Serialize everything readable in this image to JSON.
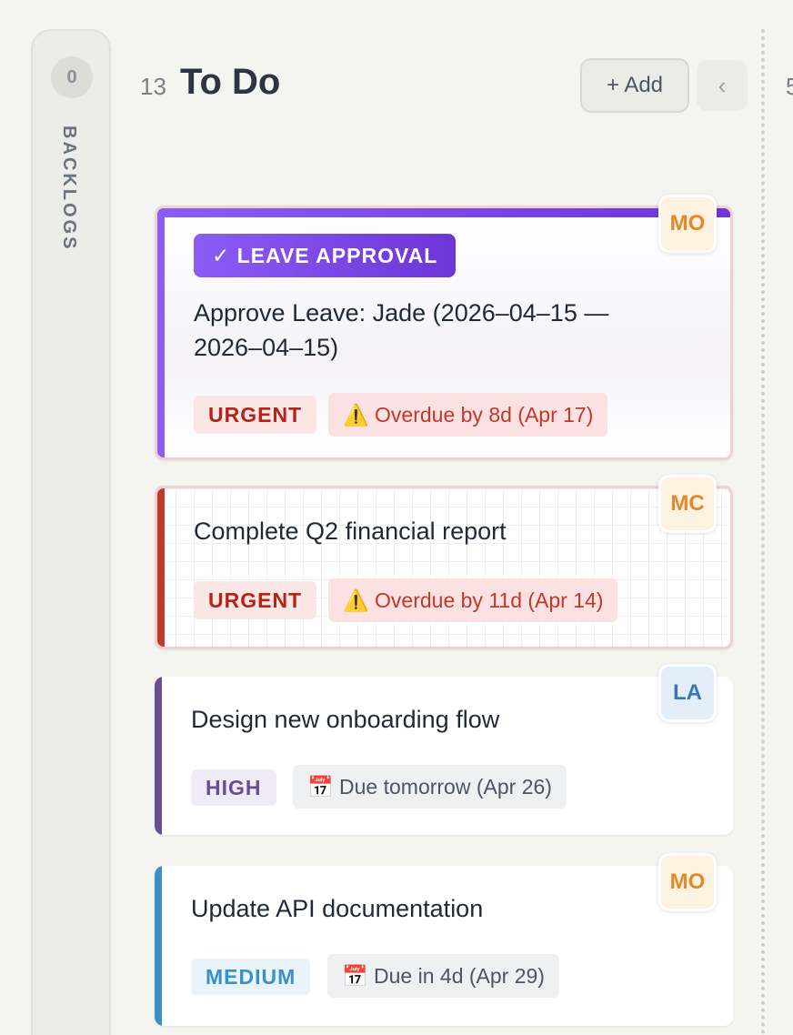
{
  "backlogs": {
    "count": "0",
    "label": "BACKLOGS"
  },
  "column": {
    "count": "13",
    "title": "To Do",
    "add_label": "+ Add",
    "collapse_icon": "‹",
    "next_column_count": "5"
  },
  "cards": [
    {
      "badge": "✓ LEAVE APPROVAL",
      "title_line1": "Approve Leave: Jade (2026–04–15 —",
      "title_line2": "2026–04–15)",
      "priority": "URGENT",
      "due": "⚠️ Overdue by 8d (Apr 17)",
      "avatar": "MO",
      "stripe_color": "#8b5cf6"
    },
    {
      "title": "Complete Q2 financial report",
      "priority": "URGENT",
      "due": "⚠️ Overdue by 11d (Apr 14)",
      "avatar": "MC",
      "stripe_color": "#c0392b"
    },
    {
      "title": "Design new onboarding flow",
      "priority": "HIGH",
      "due": "📅 Due tomorrow (Apr 26)",
      "avatar": "LA",
      "stripe_color": "#6a4c93"
    },
    {
      "title": "Update API documentation",
      "priority": "MEDIUM",
      "due": "📅 Due in 4d (Apr 29)",
      "avatar": "MO",
      "stripe_color": "#3b91c4"
    }
  ]
}
